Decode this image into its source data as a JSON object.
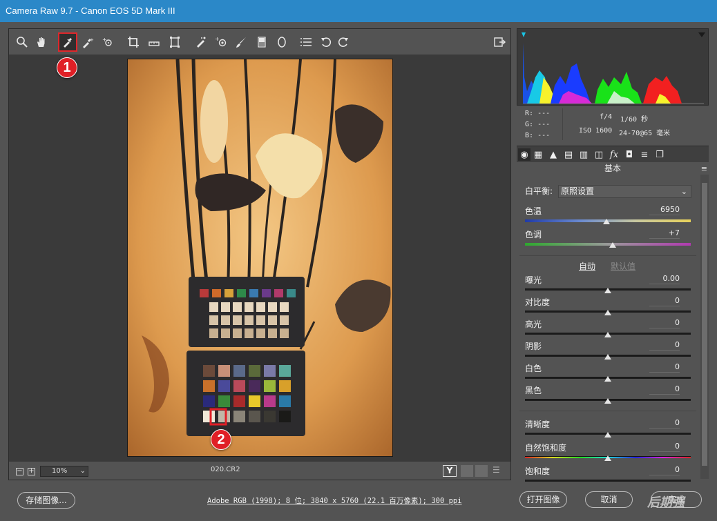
{
  "window": {
    "title": "Camera Raw 9.7  -  Canon EOS 5D Mark III"
  },
  "toolbar": {
    "tools": [
      "zoom-icon",
      "hand-icon",
      "white-balance-icon",
      "color-sampler-icon",
      "target-adjust-icon",
      "crop-icon",
      "straighten-icon",
      "transform-icon",
      "spot-removal-icon",
      "red-eye-icon",
      "brush-icon",
      "graduated-filter-icon",
      "radial-filter-icon",
      "presets-list-icon",
      "rotate-left-icon",
      "rotate-right-icon"
    ],
    "fullscreen_icon": "fullscreen-icon"
  },
  "annotations": {
    "badge1": "1",
    "badge2": "2",
    "accent_color": "#e01f26"
  },
  "status": {
    "zoom": "10%",
    "filename": "020.CR2",
    "compare_label": "Y"
  },
  "histogram": {
    "shadow_clip": "shadow-clipping-icon",
    "highlight_clip": "highlight-clipping-icon"
  },
  "info": {
    "r_label": "R:",
    "r_value": "---",
    "g_label": "G:",
    "g_value": "---",
    "b_label": "B:",
    "b_value": "---",
    "aperture": "f/4",
    "shutter": "1/60 秒",
    "iso": "ISO 1600",
    "lens": "24-70@65 毫米"
  },
  "panel": {
    "title": "基本",
    "wb_label": "白平衡:",
    "wb_value": "原照设置",
    "temp_label": "色温",
    "temp_value": "6950",
    "temp_pos": 0.49,
    "tint_label": "色调",
    "tint_value": "+7",
    "tint_pos": 0.53,
    "auto_label": "自动",
    "default_label": "默认值",
    "sliders": [
      {
        "label": "曝光",
        "value": "0.00"
      },
      {
        "label": "对比度",
        "value": "0"
      },
      {
        "label": "高光",
        "value": "0"
      },
      {
        "label": "阴影",
        "value": "0"
      },
      {
        "label": "白色",
        "value": "0"
      },
      {
        "label": "黑色",
        "value": "0"
      },
      {
        "label": "清晰度",
        "value": "0"
      },
      {
        "label": "自然饱和度",
        "value": "0"
      },
      {
        "label": "饱和度",
        "value": "0"
      }
    ]
  },
  "footer": {
    "save_label": "存储图像...",
    "workflow_link": "Adobe RGB (1998); 8 位; 3840 x 5760 (22.1 百万像素); 300 ppi",
    "open_label": "打开图像",
    "cancel_label": "取消",
    "done_label": "完成",
    "watermark": "后期强"
  }
}
